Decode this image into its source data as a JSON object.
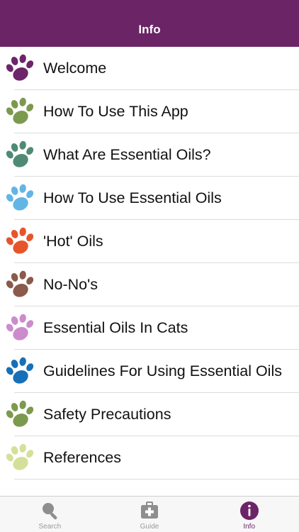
{
  "navbar": {
    "title": "Info"
  },
  "colors": {
    "nav_bg": "#6b2466",
    "accent": "#6b2466",
    "inactive_tab": "#9a9a9a"
  },
  "items": [
    {
      "label": "Welcome",
      "paw_color": "#6e2468"
    },
    {
      "label": "How To Use This App",
      "paw_color": "#7c9a4e"
    },
    {
      "label": "What Are Essential Oils?",
      "paw_color": "#4f8a74"
    },
    {
      "label": "How To Use Essential Oils",
      "paw_color": "#63b6e4"
    },
    {
      "label": "'Hot' Oils",
      "paw_color": "#e8542a"
    },
    {
      "label": "No-No's",
      "paw_color": "#8a5a4a"
    },
    {
      "label": "Essential Oils In Cats",
      "paw_color": "#cc8ccc"
    },
    {
      "label": "Guidelines For Using Essential Oils",
      "paw_color": "#1670b8"
    },
    {
      "label": "Safety Precautions",
      "paw_color": "#7c9a4e"
    },
    {
      "label": "References",
      "paw_color": "#d4e09a"
    }
  ],
  "tabbar": {
    "tabs": [
      {
        "label": "Search",
        "icon": "search-icon",
        "active": false
      },
      {
        "label": "Guide",
        "icon": "medical-kit-icon",
        "active": false
      },
      {
        "label": "Info",
        "icon": "info-icon",
        "active": true
      }
    ]
  }
}
